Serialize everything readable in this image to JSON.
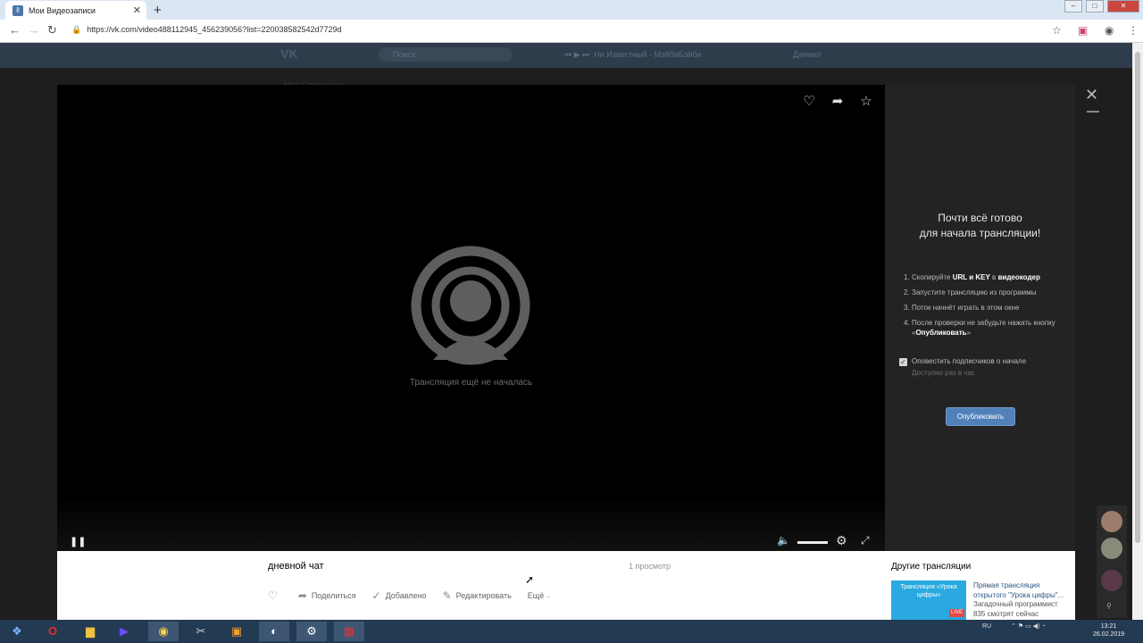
{
  "browser": {
    "tab_title": "Мои Видеозаписи",
    "url": "https://vk.com/video488112945_456239056?list=220038582542d7729d"
  },
  "vk": {
    "search_placeholder": "Поиск",
    "player_text": "Ни Известный - МэйбиБэйби",
    "user_name": "Даниил",
    "menu_item": "Моя Страница"
  },
  "player": {
    "status_message": "Трансляция ещё не началась"
  },
  "side": {
    "title_line1": "Почти всё готово",
    "title_line2": "для начала трансляции!",
    "steps": [
      {
        "num": "1.",
        "text_a": "Скопируйте ",
        "bold_a": "URL и KEY",
        "text_b": " в ",
        "bold_b": "видеокодер"
      },
      {
        "num": "2.",
        "text": "Запустите трансляцию из программы"
      },
      {
        "num": "3.",
        "text": "Поток начнёт играть в этом окне"
      },
      {
        "num": "4.",
        "text_a": "После проверки не забудьте нажать кнопку «",
        "bold_a": "Опубликовать",
        "text_b": "»"
      }
    ],
    "notify_label": "Оповестить подписчиков о начале",
    "notify_sub": "Доступно раз в час",
    "notify_checked": true,
    "publish_label": "Опубликовать"
  },
  "video": {
    "title": "дневной чат",
    "views": "1 просмотр",
    "share_label": "Поделиться",
    "added_label": "Добавлено",
    "edit_label": "Редактировать",
    "more_label": "Ещё"
  },
  "other": {
    "heading": "Другие трансляции",
    "thumb_text": "Трансляция «Урока цифры»",
    "thumb_badge": "LIVE",
    "title": "Прямая трансляция открытого \"Урока цифры\"...",
    "author": "Загадочный программист",
    "views": "835 смотрят сейчас"
  },
  "taskbar": {
    "lang": "RU",
    "time": "13:21",
    "date": "26.02.2019"
  },
  "colors": {
    "accent": "#5181b8",
    "link": "#2a5885",
    "taskbar": "#233a53"
  }
}
